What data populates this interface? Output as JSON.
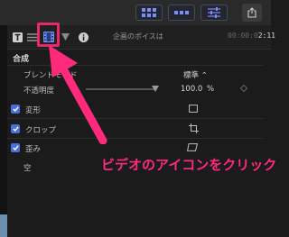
{
  "toolbar": {
    "view_buttons": [
      "browser-view-icon",
      "timeline-view-icon",
      "inspector-view-icon"
    ],
    "share_icon": "share-icon"
  },
  "inspector": {
    "tabs": [
      "text-icon",
      "title-icon",
      "video-icon",
      "filter-icon",
      "info-icon"
    ],
    "title": "企画のポイスは",
    "timecode_dim": "00:00:0",
    "timecode_bright": "2:11"
  },
  "compositing": {
    "section_label": "合成",
    "blend_mode_label": "ブレンドモード",
    "blend_mode_value": "標準 ⌃",
    "opacity_label": "不透明度",
    "opacity_value": "100.0",
    "opacity_unit": "%",
    "opacity_fraction": 1.0
  },
  "effects": [
    {
      "label": "変形",
      "checked": true,
      "icon": "transform-icon"
    },
    {
      "label": "クロップ",
      "checked": true,
      "icon": "crop-icon"
    },
    {
      "label": "歪み",
      "checked": true,
      "icon": "distort-icon"
    }
  ],
  "partial_row_label": "空",
  "annotation": {
    "text": "ビデオのアイコンをクリック",
    "color": "#ff2a7b"
  },
  "colors": {
    "accent_blue": "#4a6fd8",
    "highlight_pink": "#e8286a"
  }
}
